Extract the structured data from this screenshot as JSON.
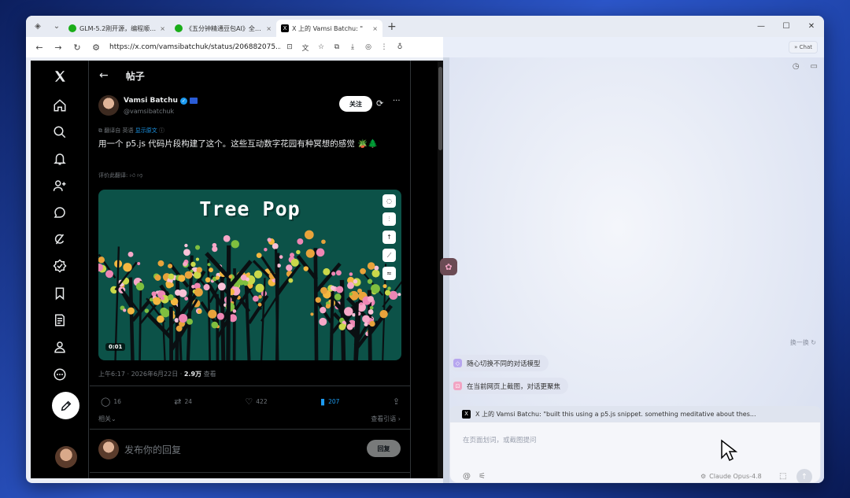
{
  "tabs": [
    {
      "icon": "wechat-icon",
      "title": "GLM-5.2刚开源，编程顺手到"
    },
    {
      "icon": "wechat-icon",
      "title": "《五分钟精通豆包AI》全网最"
    },
    {
      "icon": "x-icon",
      "title": "X 上的 Vamsi Batchu: \"",
      "active": true
    }
  ],
  "address": {
    "url": "https://x.com/vamsibatchuk/status/206882075..."
  },
  "sidebar_panel": {
    "chat_label": "Chat"
  },
  "x": {
    "header_title": "帖子",
    "author": {
      "name": "Vamsi Batchu",
      "handle": "@vamsibatchuk"
    },
    "follow_label": "关注",
    "translation_note": "翻译自 英语",
    "show_original": "显示原文",
    "text": "用一个 p5.js 代码片段构建了这个。这些互动数字花园有种冥想的感觉 🪴🌲",
    "rate_translation": "评价此翻译:",
    "media": {
      "title": "Tree Pop",
      "duration": "0:01"
    },
    "time": "上午6:17 · 2026年6月22日 · ",
    "views_count": "2.9万",
    "views_label": " 查看",
    "stats": {
      "replies": "16",
      "reposts": "24",
      "likes": "422",
      "bookmarks": "207"
    },
    "related": "相关",
    "view_quotes": "查看引语",
    "reply_placeholder": "发布你的回复",
    "reply_button": "回复"
  },
  "assistant": {
    "swap_label": "换一换",
    "suggestions": [
      "随心切换不同的对话模型",
      "在当前网页上截图，对话更聚焦"
    ],
    "context_title": "X 上的 Vamsi Batchu: \"built this using a p5.js snippet. something meditative about thes...",
    "input_placeholder": "在页面划词，或截图提问",
    "model": "Claude Opus-4.8"
  },
  "colors": {
    "accent": "#1d9bf0",
    "x_bg": "#000000",
    "media_bg": "#0c5248"
  }
}
